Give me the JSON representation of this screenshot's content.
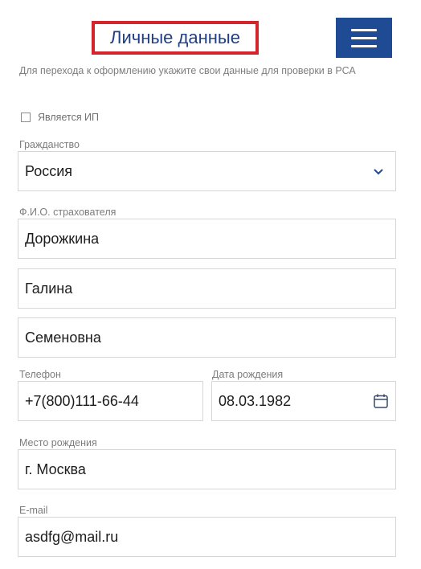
{
  "header": {
    "title": "Личные данные",
    "menu_icon": "hamburger-menu-icon"
  },
  "hint": "Для перехода к оформлению укажите свои данные для проверки в РСА",
  "ip_checkbox": {
    "label": "Является ИП",
    "checked": false
  },
  "citizenship": {
    "label": "Гражданство",
    "value": "Россия",
    "icon": "chevron-down-icon"
  },
  "fio": {
    "label": "Ф.И.О. страхователя",
    "last_name": "Дорожкина",
    "first_name": "Галина",
    "middle_name": "Семеновна"
  },
  "phone": {
    "label": "Телефон",
    "value": "+7(800)111-66-44"
  },
  "birth_date": {
    "label": "Дата рождения",
    "value": "08.03.1982",
    "icon": "calendar-icon"
  },
  "birth_place": {
    "label": "Место рождения",
    "value": "г. Москва"
  },
  "email": {
    "label": "E-mail",
    "value": "asdfg@mail.ru"
  },
  "colors": {
    "accent": "#1f4b94",
    "title_text": "#1f3f87",
    "highlight_border": "#d4242c"
  }
}
